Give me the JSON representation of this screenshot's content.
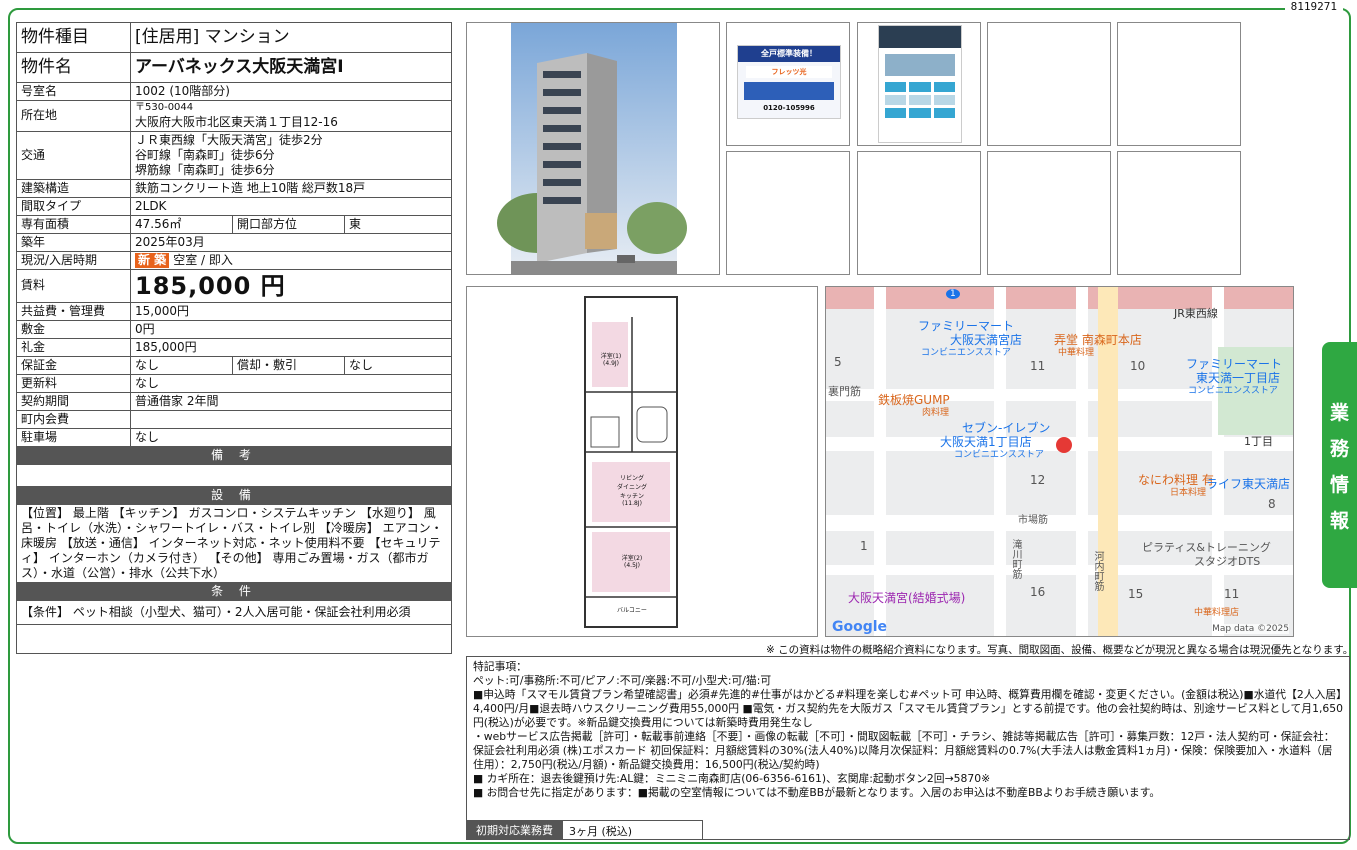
{
  "doc_id": "8119271",
  "property": {
    "type_label": "物件種目",
    "type_value": "[住居用] マンション",
    "name_label": "物件名",
    "name_value": "アーバネックス大阪天満宮Ⅰ",
    "room_label": "号室名",
    "room_value": "1002 (10階部分)",
    "address_label": "所在地",
    "postal": "〒530-0044",
    "address": "大阪府大阪市北区東天満１丁目12-16",
    "transit_label": "交通",
    "transit": [
      "ＪＲ東西線「大阪天満宮」徒歩2分",
      "谷町線「南森町」徒歩6分",
      "堺筋線「南森町」徒歩6分"
    ],
    "structure_label": "建築構造",
    "structure_value": "鉄筋コンクリート造 地上10階 総戸数18戸",
    "layout_label": "間取タイプ",
    "layout_value": "2LDK",
    "area_label": "専有面積",
    "area_value": "47.56㎡",
    "direction_label": "開口部方位",
    "direction_value": "東",
    "built_label": "築年",
    "built_value": "2025年03月",
    "status_label": "現況/入居時期",
    "status_badge": "新 築",
    "status_value": "空室 / 即入",
    "rent_label": "賃料",
    "rent_value": "185,000 円",
    "common_label": "共益費・管理費",
    "common_value": "15,000円",
    "deposit_label": "敷金",
    "deposit_value": "0円",
    "key_money_label": "礼金",
    "key_money_value": "185,000円",
    "guarantee_label": "保証金",
    "guarantee_value": "なし",
    "amort_label": "償却・敷引",
    "amort_value": "なし",
    "renewal_label": "更新料",
    "renewal_value": "なし",
    "contract_label": "契約期間",
    "contract_value": "普通借家 2年間",
    "town_fee_label": "町内会費",
    "town_fee_value": "",
    "parking_label": "駐車場",
    "parking_value": "なし"
  },
  "sections": {
    "remarks_title": "備 考",
    "equipment_title": "設 備",
    "equipment_text": "【位置】 最上階 【キッチン】 ガスコンロ・システムキッチン 【水廻り】 風呂・トイレ（水洗）・シャワートイレ・バス・トイレ別 【冷暖房】 エアコン・床暖房 【放送・通信】 インターネット対応・ネット使用料不要 【セキュリティ】 インターホン（カメラ付き） 【その他】 専用ごみ置場・ガス（都市ガス）・水道（公営）・排水（公共下水）",
    "conditions_title": "条 件",
    "conditions_text": "【条件】 ペット相談（小型犬、猫可）・2人入居可能・保証会社利用必須"
  },
  "floorplan": {
    "room1": "洋室(1)\n(4.9J)",
    "living": "リビング\nダイニング\nキッチン\n(11.8J)",
    "room2": "洋室(2)\n(4.5J)",
    "balcony": "バルコニー"
  },
  "map": {
    "labels": [
      "JR東西線",
      "ファミリーマート",
      "大阪天満宮店",
      "コンビニエンスストア",
      "弄堂 南森町本店",
      "中華料理",
      "ファミリーマート",
      "東天満一丁目店",
      "コンビニエンスストア",
      "鉄板焼GUMP",
      "肉料理",
      "セブン-イレブン",
      "大阪天満1丁目店",
      "コンビニエンスストア",
      "1丁目",
      "なにわ料理 有",
      "日本料理",
      "ライフ東天満店",
      "ピラティス&トレーニング",
      "スタジオDTS",
      "大阪天満宮(結婚式場)",
      "中華料理店",
      "5",
      "11",
      "10",
      "12",
      "8",
      "1",
      "16",
      "15",
      "11",
      "1"
    ],
    "roads": [
      "裏門筋",
      "滝川町筋",
      "市場筋",
      "河内町筋"
    ],
    "brand": "Google",
    "credit": "Map data ©2025"
  },
  "disclaimer": "※ この資料は物件の概略紹介資料になります。写真、間取図面、設備、概要などが現況と異なる場合は現況優先となります。",
  "special": {
    "title": "特記事項：",
    "lines": [
      "ペット:可/事務所:不可/ピアノ:不可/楽器:不可/小型犬:可/猫:可",
      "■申込時「スマモル賃貸プラン希望確認書」必須#先進的#仕事がはかどる#料理を楽しむ#ペット可 申込時、概算費用欄を確認・変更ください。(金額は税込)■水道代【2人入居】4,400円/月■退去時ハウスクリーニング費用55,000円 ■電気・ガス契約先を大阪ガス「スマモル賃貸プラン」とする前提です。他の会社契約時は、別途サービス料として月1,650円(税込)が必要です。※新品鍵交換費用については新築時費用発生なし",
      "・webサービス広告掲載［許可］・転載事前連絡［不要］・画像の転載［不可］・間取図転載［不可］・チラシ、雑誌等掲載広告［許可］・募集戸数：12戸・法人契約可・保証会社：保証会社利用必須 (株)エポスカード 初回保証料：月額総賃料の30%(法人40%)以降月次保証料：月額総賃料の0.7%(大手法人は敷金賃料1ヵ月)・保険：保険要加入・水道料（居住用）：2,750円(税込/月額)・新品鍵交換費用：16,500円(税込/契約時)",
      "■ カギ所在：退去後鍵預け先:AL鍵：ミニミニ南森町店(06-6356-6161)、玄関扉:起動ボタン2回→5870※",
      "■ お問合せ先に指定があります：■掲載の空室情報については不動産BBが最新となります。入居のお申込は不動産BBよりお手続き願います。"
    ]
  },
  "initial_fee": {
    "label": "初期対応業務費",
    "value": "3ヶ月 (税込)"
  },
  "side_tab": [
    "業",
    "務",
    "情",
    "報"
  ],
  "flyer1": {
    "headline": "全戸標準装備！",
    "brand": "フレッツ光",
    "tel": "0120-105996"
  },
  "colors": {
    "accent": "#2e9a3e",
    "badge": "#e8621b",
    "bar": "#555555"
  }
}
